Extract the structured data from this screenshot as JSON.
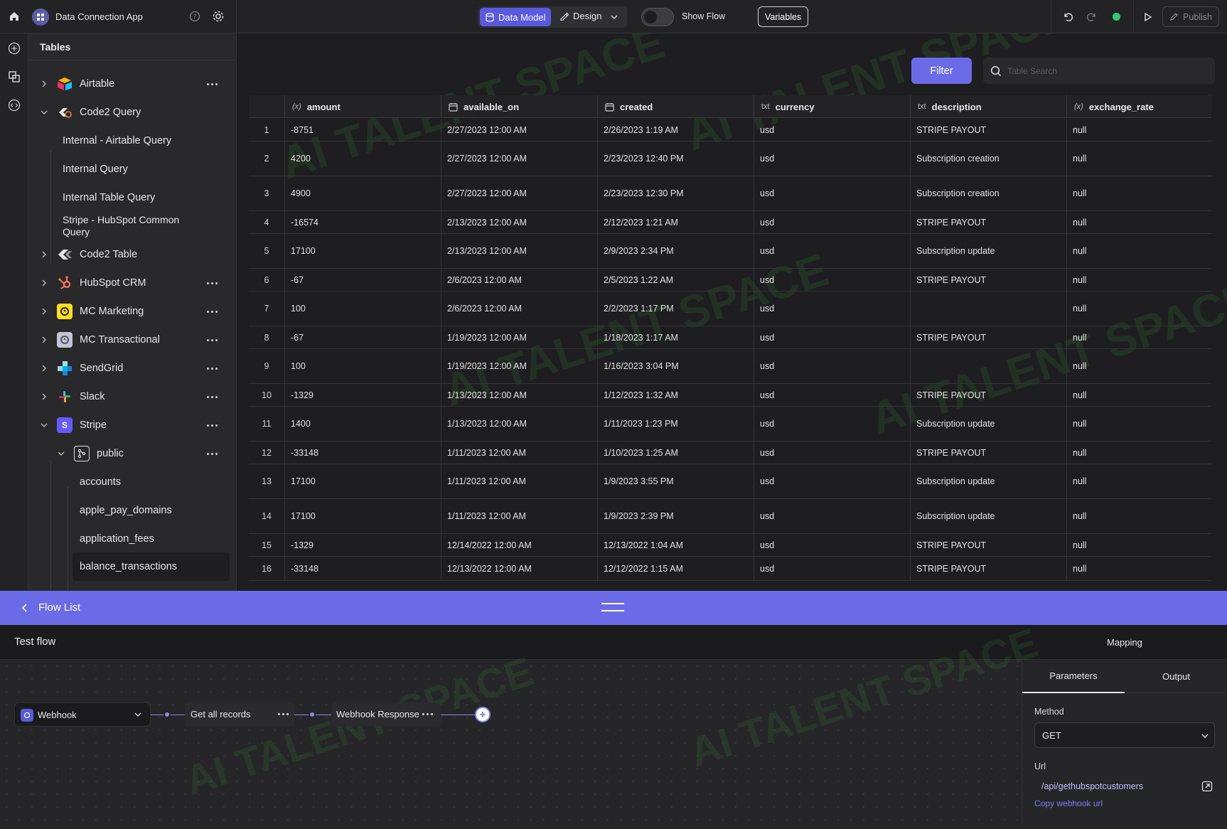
{
  "app": {
    "title": "Data Connection App"
  },
  "topbar": {
    "data_model_label": "Data Model",
    "design_label": "Design",
    "show_flow_label": "Show Flow",
    "variables_label": "Variables",
    "publish_label": "Publish",
    "status_color": "#2ecc71"
  },
  "sidebar": {
    "title": "Tables",
    "items": [
      {
        "label": "Airtable",
        "icon": "airtable-logo-icon",
        "expanded": false
      },
      {
        "label": "Code2 Query",
        "icon": "code2-query-icon",
        "expanded": true
      },
      {
        "label": "Internal - Airtable Query"
      },
      {
        "label": "Internal Query"
      },
      {
        "label": "Internal Table Query"
      },
      {
        "label": "Stripe - HubSpot Common",
        "label2": "Query"
      },
      {
        "label": "Code2 Table",
        "icon": "code2-table-icon",
        "expanded": false
      },
      {
        "label": "HubSpot CRM",
        "icon": "hubspot-logo-icon",
        "expanded": false
      },
      {
        "label": "MC Marketing",
        "icon": "mailchimp-logo-icon",
        "expanded": false
      },
      {
        "label": "MC Transactional",
        "icon": "mandrill-logo-icon",
        "expanded": false
      },
      {
        "label": "SendGrid",
        "icon": "sendgrid-logo-icon",
        "expanded": false
      },
      {
        "label": "Slack",
        "icon": "slack-logo-icon",
        "expanded": false
      },
      {
        "label": "Stripe",
        "icon": "stripe-logo-icon",
        "logo_letter": "S",
        "expanded": true
      },
      {
        "label": "public",
        "icon": "schema-icon",
        "expanded": true
      },
      {
        "label": "accounts"
      },
      {
        "label": "apple_pay_domains"
      },
      {
        "label": "application_fees"
      },
      {
        "label": "balance_transactions",
        "selected": true
      }
    ]
  },
  "main": {
    "filter_label": "Filter",
    "search_placeholder": "Table Search",
    "columns": [
      {
        "name": "amount",
        "type_icon": "(x)"
      },
      {
        "name": "available_on",
        "type_icon": "calendar-icon"
      },
      {
        "name": "created",
        "type_icon": "calendar-icon"
      },
      {
        "name": "currency",
        "type_icon": "txt"
      },
      {
        "name": "description",
        "type_icon": "txt"
      },
      {
        "name": "exchange_rate",
        "type_icon": "(x)"
      }
    ],
    "rows": [
      [
        "1",
        "-8751",
        "2/27/2023 12:00 AM",
        "2/26/2023 1:19 AM",
        "usd",
        "STRIPE PAYOUT",
        "null"
      ],
      [
        "2",
        "4200",
        "2/27/2023 12:00 AM",
        "2/23/2023 12:40 PM",
        "usd",
        "Subscription creation",
        "null"
      ],
      [
        "3",
        "4900",
        "2/27/2023 12:00 AM",
        "2/23/2023 12:30 PM",
        "usd",
        "Subscription creation",
        "null"
      ],
      [
        "4",
        "-16574",
        "2/13/2023 12:00 AM",
        "2/12/2023 1:21 AM",
        "usd",
        "STRIPE PAYOUT",
        "null"
      ],
      [
        "5",
        "17100",
        "2/13/2023 12:00 AM",
        "2/9/2023 2:34 PM",
        "usd",
        "Subscription update",
        "null"
      ],
      [
        "6",
        "-67",
        "2/6/2023 12:00 AM",
        "2/5/2023 1:22 AM",
        "usd",
        "STRIPE PAYOUT",
        "null"
      ],
      [
        "7",
        "100",
        "2/6/2023 12:00 AM",
        "2/2/2023 1:17 PM",
        "usd",
        "",
        "null"
      ],
      [
        "8",
        "-67",
        "1/19/2023 12:00 AM",
        "1/18/2023 1:17 AM",
        "usd",
        "STRIPE PAYOUT",
        "null"
      ],
      [
        "9",
        "100",
        "1/19/2023 12:00 AM",
        "1/16/2023 3:04 PM",
        "usd",
        "",
        "null"
      ],
      [
        "10",
        "-1329",
        "1/13/2023 12:00 AM",
        "1/12/2023 1:32 AM",
        "usd",
        "STRIPE PAYOUT",
        "null"
      ],
      [
        "11",
        "1400",
        "1/13/2023 12:00 AM",
        "1/11/2023 1:23 PM",
        "usd",
        "Subscription update",
        "null"
      ],
      [
        "12",
        "-33148",
        "1/11/2023 12:00 AM",
        "1/10/2023 1:25 AM",
        "usd",
        "STRIPE PAYOUT",
        "null"
      ],
      [
        "13",
        "17100",
        "1/11/2023 12:00 AM",
        "1/9/2023 3:55 PM",
        "usd",
        "Subscription update",
        "null"
      ],
      [
        "14",
        "17100",
        "1/11/2023 12:00 AM",
        "1/9/2023 2:39 PM",
        "usd",
        "Subscription update",
        "null"
      ],
      [
        "15",
        "-1329",
        "12/14/2022 12:00 AM",
        "12/13/2022 1:04 AM",
        "usd",
        "STRIPE PAYOUT",
        "null"
      ],
      [
        "16",
        "-33148",
        "12/13/2022 12:00 AM",
        "12/12/2022 1:15 AM",
        "usd",
        "STRIPE PAYOUT",
        "null"
      ]
    ]
  },
  "flow": {
    "list_label": "Flow List",
    "title": "Test flow",
    "mapping_label": "Mapping",
    "nodes": [
      {
        "label": "Webhook"
      },
      {
        "label": "Get all records"
      },
      {
        "label": "Webhook Response"
      }
    ],
    "accent": "#6b6be8"
  },
  "panel": {
    "tabs": [
      "Parameters",
      "Output"
    ],
    "method_label": "Method",
    "method_value": "GET",
    "url_label": "Url",
    "url_value": "/api/gethubspotcustomers",
    "copy_label": "Copy webhook url"
  },
  "watermark": "AI TALENT SPACE"
}
